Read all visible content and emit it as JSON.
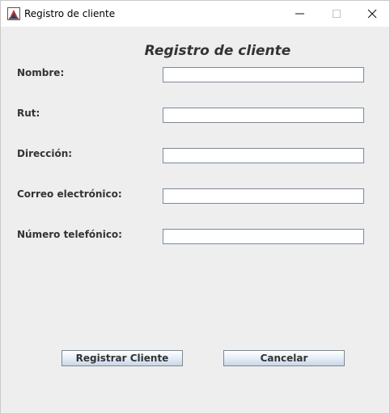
{
  "window": {
    "title": "Registro de cliente"
  },
  "form": {
    "title": "Registro de cliente",
    "fields": [
      {
        "label": "Nombre:",
        "value": ""
      },
      {
        "label": "Rut:",
        "value": ""
      },
      {
        "label": "Dirección:",
        "value": ""
      },
      {
        "label": "Correo electrónico:",
        "value": ""
      },
      {
        "label": "Número telefónico:",
        "value": ""
      }
    ]
  },
  "buttons": {
    "register_label": "Registrar Cliente",
    "cancel_label": "Cancelar"
  },
  "icons": {
    "app": "java-app-icon",
    "minimize": "minimize-icon",
    "maximize": "maximize-icon",
    "close": "close-icon"
  },
  "colors": {
    "background": "#eeeeee",
    "titlebar": "#ffffff",
    "label_text": "#333333",
    "input_border": "#7a8a99"
  }
}
